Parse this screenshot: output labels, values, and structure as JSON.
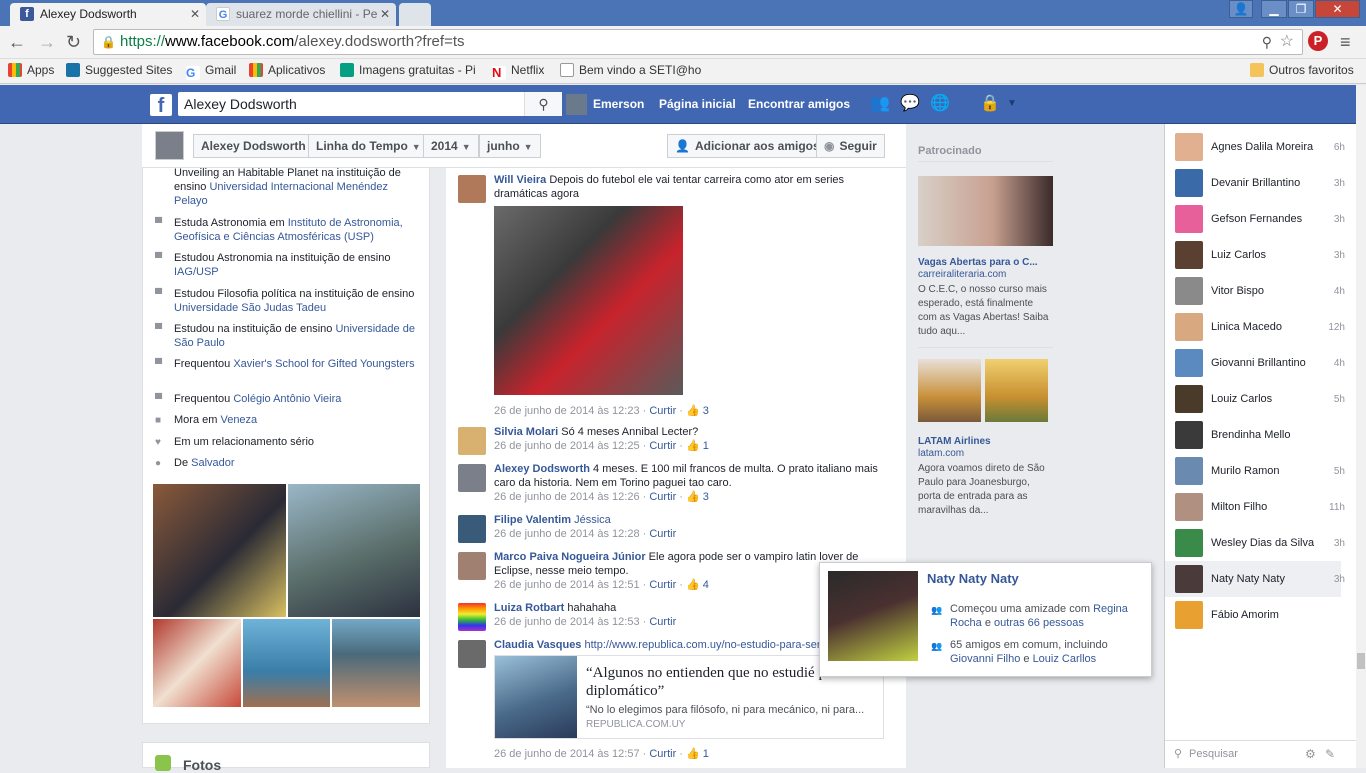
{
  "browser": {
    "tabs": [
      {
        "label": "Alexey Dodsworth"
      },
      {
        "label": "suarez morde chiellini - Pe"
      }
    ],
    "url_scheme": "https://",
    "url_host": "www.facebook.com",
    "url_path": "/alexey.dodsworth?fref=ts",
    "bookmarks": [
      "Apps",
      "Suggested Sites",
      "Gmail",
      "Aplicativos",
      "Imagens gratuitas - Pi",
      "Netflix",
      "Bem vindo a SETI@ho"
    ],
    "other_bookmarks": "Outros favoritos"
  },
  "fb": {
    "search_value": "Alexey Dodsworth",
    "user": "Emerson",
    "home": "Página inicial",
    "find_friends": "Encontrar amigos",
    "brand_color": "#4267b2"
  },
  "timeline": {
    "name": "Alexey Dodsworth",
    "section": "Linha do Tempo",
    "year": "2014",
    "month": "junho",
    "add_friend": "Adicionar aos amigos",
    "follow": "Seguir"
  },
  "about": [
    {
      "pre": "Unveiling an Habitable Planet na instituição de ensino ",
      "link": "Universidad Internacional Menéndez Pelayo",
      "icon": ""
    },
    {
      "pre": "Estuda Astronomia em ",
      "link": "Instituto de Astronomia, Geofísica e Ciências Atmosféricas (USP)",
      "icon": "school-icon"
    },
    {
      "pre": "Estudou Astronomia na instituição de ensino ",
      "link": "IAG/USP",
      "icon": "school-icon"
    },
    {
      "pre": "Estudou Filosofia política na instituição de ensino ",
      "link": "Universidade São Judas Tadeu",
      "icon": "school-icon"
    },
    {
      "pre": "Estudou na instituição de ensino ",
      "link": "Universidade de São Paulo",
      "icon": "school-icon"
    },
    {
      "pre": "Frequentou ",
      "link": "Xavier's School for Gifted Youngsters",
      "icon": "school-icon"
    },
    {
      "pre": "Frequentou ",
      "link": "Colégio Antônio Vieira",
      "icon": "school-icon"
    },
    {
      "pre": "Mora em ",
      "link": "Veneza",
      "icon": "home-icon"
    },
    {
      "pre": "Em um relacionamento sério",
      "link": "",
      "icon": "heart-icon"
    },
    {
      "pre": "De ",
      "link": "Salvador",
      "icon": "pin-icon"
    }
  ],
  "photos_label": "Fotos",
  "comments": [
    {
      "name": "Will Vieira",
      "text": "Depois do futebol ele vai tentar carreira como ator em series dramáticas agora",
      "date": "26 de junho de 2014 às 12:23",
      "reply": "Curtir",
      "likes": "3"
    },
    {
      "name": "Silvia Molari",
      "text": "Só 4 meses Annibal Lecter?",
      "date": "26 de junho de 2014 às 12:25",
      "reply": "Curtir",
      "likes": "1"
    },
    {
      "name": "Alexey Dodsworth",
      "text": "4 meses. E 100 mil francos de multa. O prato italiano mais caro da historia. Nem em Torino paguei tao caro.",
      "date": "26 de junho de 2014 às 12:26",
      "reply": "Curtir",
      "likes": "3"
    },
    {
      "name": "Filipe Valentim",
      "text": "Jéssica",
      "date": "26 de junho de 2014 às 12:28",
      "reply": "Curtir",
      "likes": ""
    },
    {
      "name": "Marco Paiva Nogueira Júnior",
      "text": "Ele agora pode ser o vampiro latin lover de Eclipse, nesse meio tempo.",
      "date": "26 de junho de 2014 às 12:51",
      "reply": "Curtir",
      "likes": "4"
    },
    {
      "name": "Luiza Rotbart",
      "text": "hahahaha",
      "date": "26 de junho de 2014 às 12:53",
      "reply": "Curtir",
      "likes": ""
    },
    {
      "name": "Claudia Vasques",
      "text": "http://www.republica.com.uy/no-estudio-para-ser-",
      "date": "26 de junho de 2014 às 12:57",
      "reply": "Curtir",
      "likes": "1"
    }
  ],
  "link_preview": {
    "title": "“Algunos no entienden que no estudié para ser diplomático”",
    "desc": "“No lo elegimos para filósofo, ni para mecánico, ni para...",
    "domain": "REPUBLICA.COM.UY"
  },
  "ads": {
    "label": "Patrocinado",
    "items": [
      {
        "title": "Vagas Abertas para o C...",
        "domain": "carreiraliteraria.com",
        "text": "O C.E.C, o nosso curso mais esperado, está finalmente com as Vagas Abertas! Saiba tudo aqu..."
      },
      {
        "title": "LATAM Airlines",
        "domain": "latam.com",
        "text": "Agora voamos direto de São Paulo para Joanesburgo, porta de entrada para as maravilhas da..."
      }
    ]
  },
  "chat": {
    "contacts": [
      {
        "name": "Agnes Dalila Moreira",
        "time": "6h"
      },
      {
        "name": "Devanir Brillantino",
        "time": "3h"
      },
      {
        "name": "Gefson Fernandes",
        "time": "3h"
      },
      {
        "name": "Luiz Carlos",
        "time": "3h"
      },
      {
        "name": "Vitor Bispo",
        "time": "4h"
      },
      {
        "name": "Linica Macedo",
        "time": "12h"
      },
      {
        "name": "Giovanni Brillantino",
        "time": "4h"
      },
      {
        "name": "Louiz Carlos",
        "time": "5h"
      },
      {
        "name": "Brendinha Mello",
        "time": ""
      },
      {
        "name": "Murilo Ramon",
        "time": "5h"
      },
      {
        "name": "Milton Filho",
        "time": "11h"
      },
      {
        "name": "Wesley Dias da Silva",
        "time": "3h"
      },
      {
        "name": "Naty Naty Naty",
        "time": "3h"
      },
      {
        "name": "Fábio Amorim",
        "time": ""
      }
    ],
    "search_placeholder": "Pesquisar"
  },
  "hovercard": {
    "name": "Naty Naty Naty",
    "friendship_pre": "Começou uma amizade com ",
    "friendship_a": "Regina Rocha",
    "friendship_mid": " e ",
    "friendship_b": "outras 66 pessoas",
    "mutual_pre": "65 amigos em comum, incluindo ",
    "mutual_a": "Giovanni Filho",
    "mutual_mid": " e ",
    "mutual_b": "Louiz Carllos"
  }
}
